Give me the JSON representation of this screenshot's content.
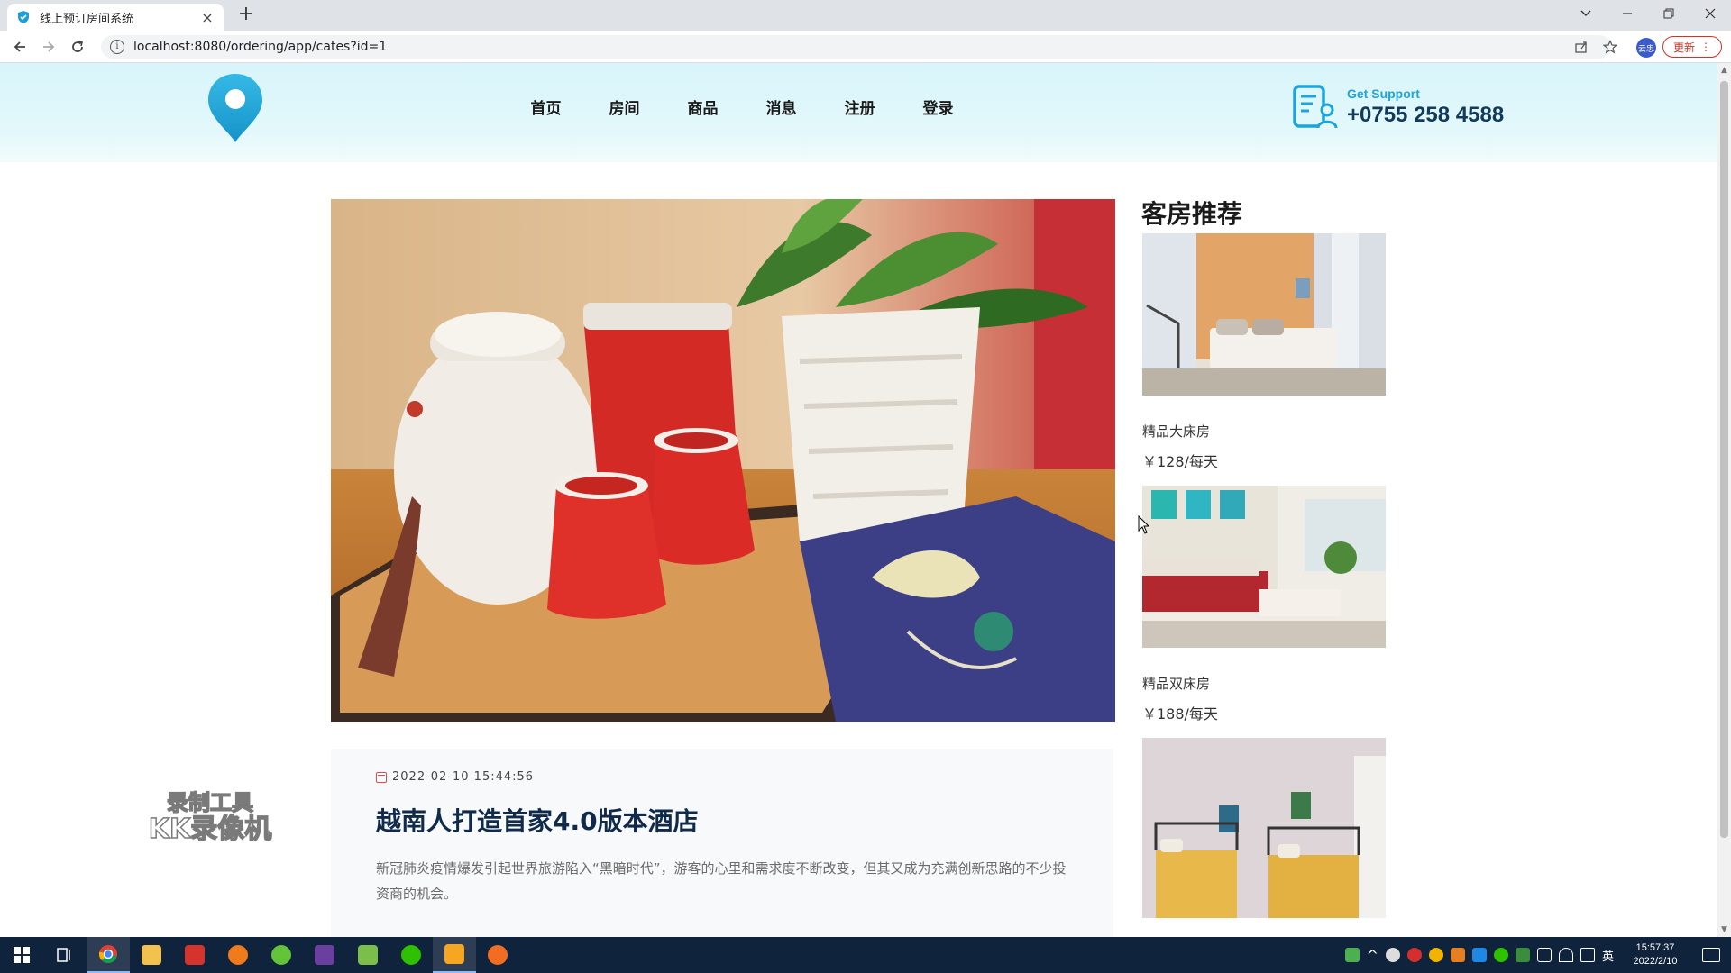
{
  "browser": {
    "tab_title": "线上预订房间系统",
    "url": "localhost:8080/ordering/app/cates?id=1",
    "profile_text": "云忠",
    "update_label": "更新",
    "new_tab_symbol": "+",
    "close_symbol": "×"
  },
  "site": {
    "nav": [
      "首页",
      "房间",
      "商品",
      "消息",
      "注册",
      "登录"
    ],
    "support_label": "Get Support",
    "support_phone": "+0755 258 4588"
  },
  "post": {
    "date": "2022-02-10 15:44:56",
    "title": "越南人打造首家4.0版本酒店",
    "excerpt": "新冠肺炎疫情爆发引起世界旅游陷入“黑暗时代”，游客的心里和需求度不断改变，但其又成为充满创新思路的不少投资商的机会。"
  },
  "sidebar": {
    "title": "客房推荐",
    "rooms": [
      {
        "name": "精品大床房",
        "price": "￥128/每天"
      },
      {
        "name": "精品双床房",
        "price": "￥188/每天"
      }
    ]
  },
  "watermark": {
    "line1": "录制工具",
    "line2": "KK录像机"
  },
  "taskbar": {
    "time": "15:57:37",
    "date": "2022/2/10",
    "ime": "英"
  },
  "colors": {
    "accent": "#1fa4d9",
    "header_bg": "#dff6fb",
    "title_dark": "#0f2a4a",
    "taskbar": "#10233c"
  }
}
